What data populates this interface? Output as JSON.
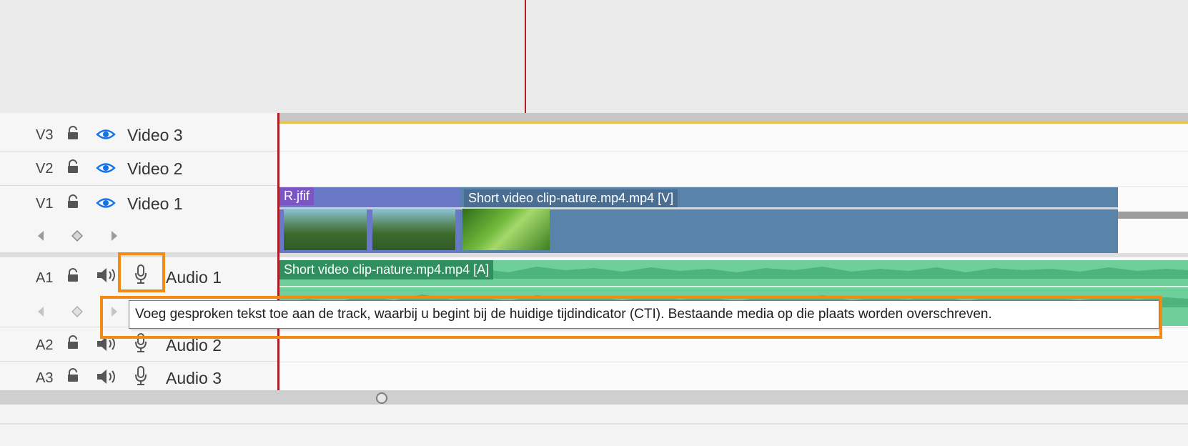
{
  "tracks": {
    "v3": {
      "id": "V3",
      "name": "Video 3"
    },
    "v2": {
      "id": "V2",
      "name": "Video 2"
    },
    "v1": {
      "id": "V1",
      "name": "Video 1"
    },
    "a1": {
      "id": "A1",
      "name": "Audio 1"
    },
    "a2": {
      "id": "A2",
      "name": "Audio 2"
    },
    "a3": {
      "id": "A3",
      "name": "Audio 3"
    }
  },
  "clips": {
    "image_clip": "R.jfif",
    "video_clip": "Short video clip-nature.mp4.mp4 [V]",
    "audio_clip": "Short video clip-nature.mp4.mp4 [A]"
  },
  "tooltip": {
    "text": "Voeg gesproken tekst toe aan de track, waarbij u begint bij de huidige tijdindicator (CTI). Bestaande media op die plaats worden overschreven."
  },
  "colors": {
    "accent_highlight": "#f28a16",
    "playhead": "#a81e26",
    "video_clip": "#5983ab",
    "image_clip": "#6979c8",
    "audio_clip": "#6fcf9b",
    "eye_icon": "#1473e6"
  },
  "icons": [
    "lock-icon",
    "eye-icon",
    "speaker-icon",
    "microphone-icon",
    "prev-keyframe-icon",
    "add-keyframe-icon",
    "next-keyframe-icon"
  ]
}
